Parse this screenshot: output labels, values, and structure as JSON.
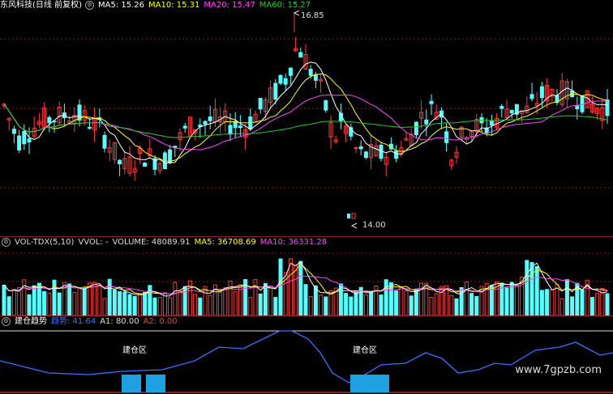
{
  "main": {
    "title": "东风科技(日线 前复权)",
    "ma5_label": "MA5: 15.26",
    "ma10_label": "MA10: 15.31",
    "ma20_label": "MA20: 15.47",
    "ma60_label": "MA60: 15.27",
    "high_label": "16.85",
    "low_label": "14.00"
  },
  "volume": {
    "title": "VOL-TDX(5,10)",
    "vvol_label": "VVOL: -",
    "volume_label": "VOLUME: 48089.91",
    "ma5_label": "MA5: 36708.69",
    "ma10_label": "MA10: 36331.28"
  },
  "indicator": {
    "title": "建仓趋势",
    "trend_label": "趋势: 41.64",
    "a1_label": "A1: 80.00",
    "a2_label": "A2: 0.00",
    "zone_label_1": "建仓区",
    "zone_label_2": "建仓区"
  },
  "watermark": "www.7gpzb.com",
  "colors": {
    "up": "#ff3a3a",
    "down": "#54ffff",
    "ma5": "#ffffff",
    "ma10": "#ffff00",
    "ma20": "#ff44ff",
    "ma60": "#22cc22",
    "trend": "#3b6fff",
    "grid": "#8a1d1d"
  }
}
